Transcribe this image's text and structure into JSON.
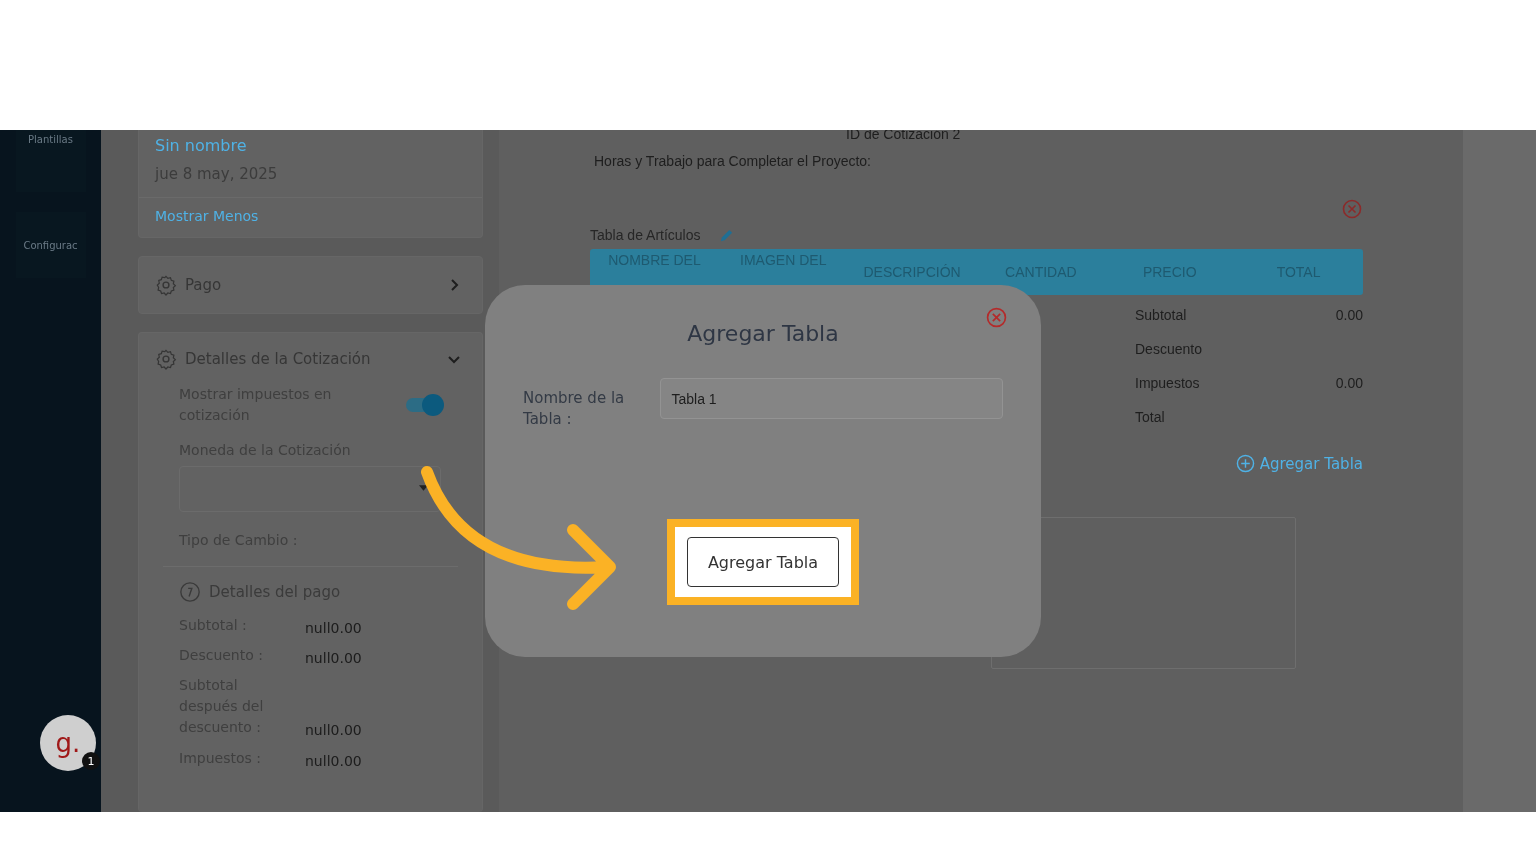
{
  "sidebar": {
    "items": [
      {
        "label": "Plantillas"
      },
      {
        "label": "Configurac"
      }
    ],
    "avatar": {
      "letter": "g.",
      "badge": "1"
    }
  },
  "quote_card": {
    "name": "Sin nombre",
    "date": "jue 8 may, 2025",
    "toggle_link": "Mostrar Menos"
  },
  "payment_section": {
    "title": "Pago",
    "expanded": false
  },
  "details_section": {
    "title": "Detalles de la Cotización",
    "expanded": true,
    "tax_toggle": {
      "label": "Mostrar impuestos en cotización",
      "on": true
    },
    "currency": {
      "label": "Moneda de la Cotización"
    },
    "exchange_rate": {
      "label": "Tipo de Cambio :"
    },
    "payment_details": {
      "title": "Detalles del pago",
      "rows": [
        {
          "label": "Subtotal :",
          "value": "null0.00"
        },
        {
          "label": "Descuento :",
          "value": "null0.00"
        },
        {
          "label": "Subtotal después del descuento :",
          "value": "null0.00"
        },
        {
          "label": "Impuestos :",
          "value": "null0.00"
        }
      ]
    }
  },
  "quote": {
    "id_label": "ID de Cotización",
    "id_value": "2",
    "hours_label": "Horas y Trabajo para Completar el Proyecto:",
    "table": {
      "title": "Tabla de Artículos",
      "columns": [
        "NOMBRE DEL",
        "IMAGEN DEL",
        "DESCRIPCIÓN",
        "CANTIDAD",
        "PRECIO",
        "TOTAL"
      ]
    },
    "totals": [
      {
        "label": "Subtotal",
        "value": "0.00"
      },
      {
        "label": "Descuento"
      },
      {
        "label": "Impuestos",
        "value": "0.00"
      },
      {
        "label": "Total"
      }
    ],
    "add_table_link": "Agregar Tabla"
  },
  "dialog": {
    "title": "Agregar Tabla",
    "field_label": "Nombre de la Tabla :",
    "field_value": "Tabla 1",
    "button": "Agregar Tabla",
    "highlighted": true
  }
}
